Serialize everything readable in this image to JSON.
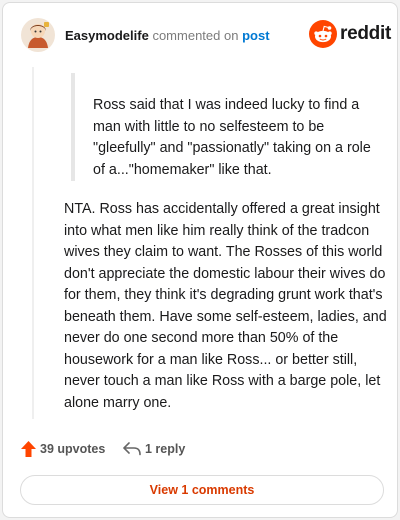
{
  "header": {
    "username": "Easymodelife",
    "action_text": "commented on",
    "post_link": "post",
    "brand": "reddit",
    "avatar_icon": "cartoon-avatar-icon",
    "brand_icon": "reddit-snoo-icon"
  },
  "quote": {
    "text": "Ross said that I was indeed lucky to find a man with little to no selfesteem to be \"gleefully\" and \"passionatly\" taking on a role of a...\"homemaker\" like that."
  },
  "comment": {
    "text": "NTA. Ross has accidentally offered a great insight into what men like him really think of the tradcon wives they claim to want. The Rosses of this world don't appreciate the domestic labour their wives do for them, they think it's degrading grunt work that's beneath them. Have some self-esteem, ladies, and never do one second more than 50% of the housework for a man like Ross... or better still, never touch a man like Ross with a barge pole, let alone marry one."
  },
  "actions": {
    "upvotes": "39 upvotes",
    "replies": "1 reply",
    "upvote_icon": "upvote-arrow-icon",
    "reply_icon": "reply-arrow-icon"
  },
  "footer": {
    "view_comments": "View 1 comments"
  },
  "colors": {
    "accent": "#ff4500",
    "link": "#0079d3",
    "button_text": "#d93a00"
  }
}
